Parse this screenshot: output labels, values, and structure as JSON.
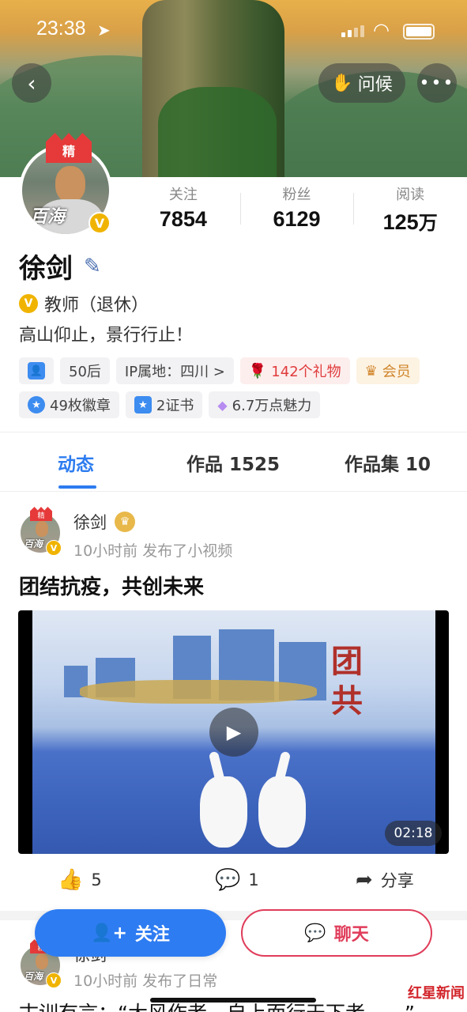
{
  "status_bar": {
    "time": "23:38"
  },
  "header": {
    "greet_label": "问候"
  },
  "profile": {
    "badge_label": "精",
    "avatar_signature": "百海",
    "stats": [
      {
        "label": "关注",
        "value": "7854"
      },
      {
        "label": "粉丝",
        "value": "6129"
      },
      {
        "label": "阅读",
        "value": "125",
        "unit": "万"
      }
    ],
    "name": "徐剑",
    "verification": "教师（退休）",
    "motto": "高山仰止，景行行止！",
    "tags_row1": [
      "50后",
      "IP属地：四川 >",
      "142个礼物",
      "会员"
    ],
    "tags_row2": [
      "49枚徽章",
      "2证书",
      "6.7万点魅力"
    ]
  },
  "tabs": [
    {
      "label": "动态",
      "active": true
    },
    {
      "label": "作品 1525",
      "active": false
    },
    {
      "label": "作品集 10",
      "active": false
    }
  ],
  "post": {
    "author": "徐剑",
    "meta": "10小时前 发布了小视频",
    "title": "团结抗疫，共创未来",
    "video_calligraphy": "团共",
    "duration": "02:18",
    "likes": "5",
    "comments": "1",
    "share_label": "分享"
  },
  "post2": {
    "author": "徐剑",
    "meta": "10小时前 发布了日常",
    "text": "古训有言：“大风作者，自上而行天下者……”"
  },
  "bottom_bar": {
    "follow_label": "关注",
    "chat_label": "聊天"
  },
  "watermark": {
    "name": "红星新闻"
  },
  "colors": {
    "accent": "#2d7cf0",
    "chat": "#e03c5a",
    "verify": "#f0b400"
  }
}
